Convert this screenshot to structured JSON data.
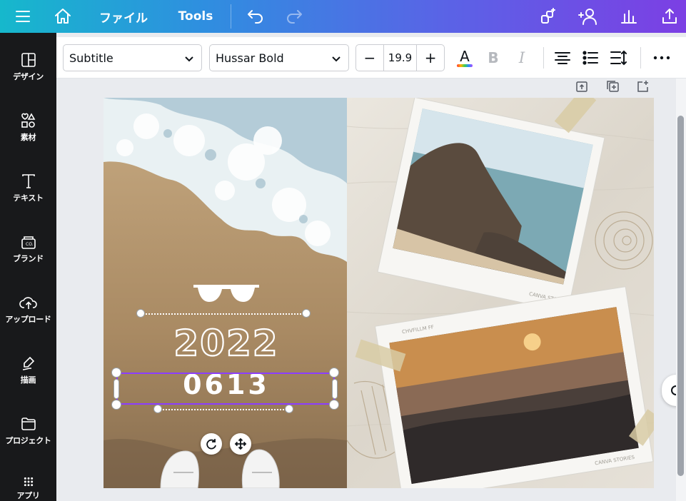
{
  "topbar": {
    "file_label": "ファイル",
    "tools_label": "Tools"
  },
  "sidebar": {
    "items": [
      {
        "label": "デザイン",
        "icon": "layout-icon"
      },
      {
        "label": "素材",
        "icon": "elements-icon"
      },
      {
        "label": "テキスト",
        "icon": "text-icon"
      },
      {
        "label": "ブランド",
        "icon": "brand-icon"
      },
      {
        "label": "アップロード",
        "icon": "upload-icon"
      },
      {
        "label": "描画",
        "icon": "draw-icon"
      },
      {
        "label": "プロジェクト",
        "icon": "folder-icon"
      },
      {
        "label": "アプリ",
        "icon": "apps-icon"
      }
    ]
  },
  "toolbar": {
    "style_value": "Subtitle",
    "font_value": "Hussar Bold",
    "font_size": "19.9",
    "minus_label": "−",
    "plus_label": "+",
    "bold_label": "B",
    "italic_label": "I",
    "text_color_letter": "A"
  },
  "design": {
    "year_text": "2022",
    "date_text": "0613",
    "polaroid_caption_1": "CANVA STORIES",
    "polaroid_caption_2": "CHVFILLM FF",
    "colors": {
      "accent": "#8b3dff",
      "text_outline": "#ffffff"
    }
  }
}
